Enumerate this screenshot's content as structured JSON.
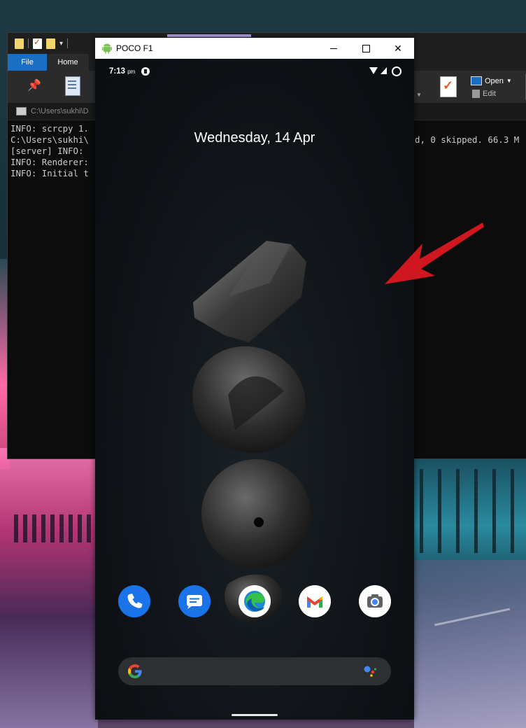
{
  "explorer": {
    "tabs": {
      "file": "File",
      "home": "Home"
    },
    "ribbon": {
      "open_label": "Open",
      "edit_label": "Edit"
    },
    "address": "C:\\Users\\sukhi\\D",
    "console_lines": [
      "INFO: scrcpy 1.",
      "C:\\Users\\sukhi\\",
      "[server] INFO: ",
      "INFO: Renderer:",
      "INFO: Initial t"
    ],
    "console_overflow_text": "d, 0 skipped. 66.3 M"
  },
  "phone_window": {
    "title": "POCO F1",
    "controls": {
      "minimize": "minimize",
      "maximize": "maximize",
      "close": "✕"
    }
  },
  "phone": {
    "status": {
      "time": "7:13",
      "time_suffix": "pm"
    },
    "date": "Wednesday, 14 Apr",
    "dock_apps": [
      "Phone",
      "Messages",
      "Edge",
      "Gmail",
      "Camera"
    ]
  },
  "colors": {
    "accent_blue": "#1a73e8",
    "file_tab": "#1a6fc4",
    "arrow_red": "#d0161e"
  }
}
